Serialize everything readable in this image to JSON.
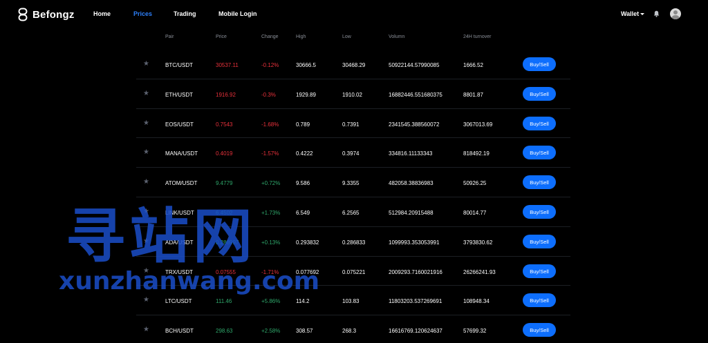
{
  "brand": {
    "name": "Befongz"
  },
  "nav": [
    {
      "label": "Home",
      "active": false
    },
    {
      "label": "Prices",
      "active": true
    },
    {
      "label": "Trading",
      "active": false
    },
    {
      "label": "Mobile Login",
      "active": false
    }
  ],
  "header": {
    "wallet_label": "Wallet"
  },
  "table": {
    "columns": [
      "Pair",
      "Price",
      "Change",
      "High",
      "Low",
      "Volumn",
      "24H turnover"
    ],
    "action_label": "Buy/Sell",
    "rows": [
      {
        "pair": "BTC/USDT",
        "price": "30537.11",
        "change": "-0.12%",
        "high": "30666.5",
        "low": "30468.29",
        "volume": "50922144.57990085",
        "turnover": "1666.52",
        "trend": "down"
      },
      {
        "pair": "ETH/USDT",
        "price": "1916.92",
        "change": "-0.3%",
        "high": "1929.89",
        "low": "1910.02",
        "volume": "16882446.551680375",
        "turnover": "8801.87",
        "trend": "down"
      },
      {
        "pair": "EOS/USDT",
        "price": "0.7543",
        "change": "-1.68%",
        "high": "0.789",
        "low": "0.7391",
        "volume": "2341545.388560072",
        "turnover": "3067013.69",
        "trend": "down"
      },
      {
        "pair": "MANA/USDT",
        "price": "0.4019",
        "change": "-1.57%",
        "high": "0.4222",
        "low": "0.3974",
        "volume": "334816.11133343",
        "turnover": "818492.19",
        "trend": "down"
      },
      {
        "pair": "ATOM/USDT",
        "price": "9.4779",
        "change": "+0.72%",
        "high": "9.586",
        "low": "9.3355",
        "volume": "482058.38836983",
        "turnover": "50926.25",
        "trend": "up"
      },
      {
        "pair": "LINK/USDT",
        "price": "6.4502",
        "change": "+1.73%",
        "high": "6.549",
        "low": "6.2565",
        "volume": "512984.20915488",
        "turnover": "80014.77",
        "trend": "up"
      },
      {
        "pair": "ADA/USDT",
        "price": "0.288997",
        "change": "+0.13%",
        "high": "0.293832",
        "low": "0.286833",
        "volume": "1099993.353053991",
        "turnover": "3793830.62",
        "trend": "up"
      },
      {
        "pair": "TRX/USDT",
        "price": "0.07555",
        "change": "-1.71%",
        "high": "0.077692",
        "low": "0.075221",
        "volume": "2009293.7160021916",
        "turnover": "26266241.93",
        "trend": "down"
      },
      {
        "pair": "LTC/USDT",
        "price": "111.46",
        "change": "+5.86%",
        "high": "114.2",
        "low": "103.83",
        "volume": "11803203.537269691",
        "turnover": "108948.34",
        "trend": "up"
      },
      {
        "pair": "BCH/USDT",
        "price": "298.63",
        "change": "+2.58%",
        "high": "308.57",
        "low": "268.3",
        "volume": "16616769.120624637",
        "turnover": "57699.32",
        "trend": "up"
      }
    ]
  },
  "watermark": {
    "chinese": "寻站网",
    "latin": "xunzhanwang.com"
  },
  "colors": {
    "background": "#000000",
    "accent": "#0d6efd",
    "negative": "#e8313b",
    "positive": "#2fa86b"
  }
}
